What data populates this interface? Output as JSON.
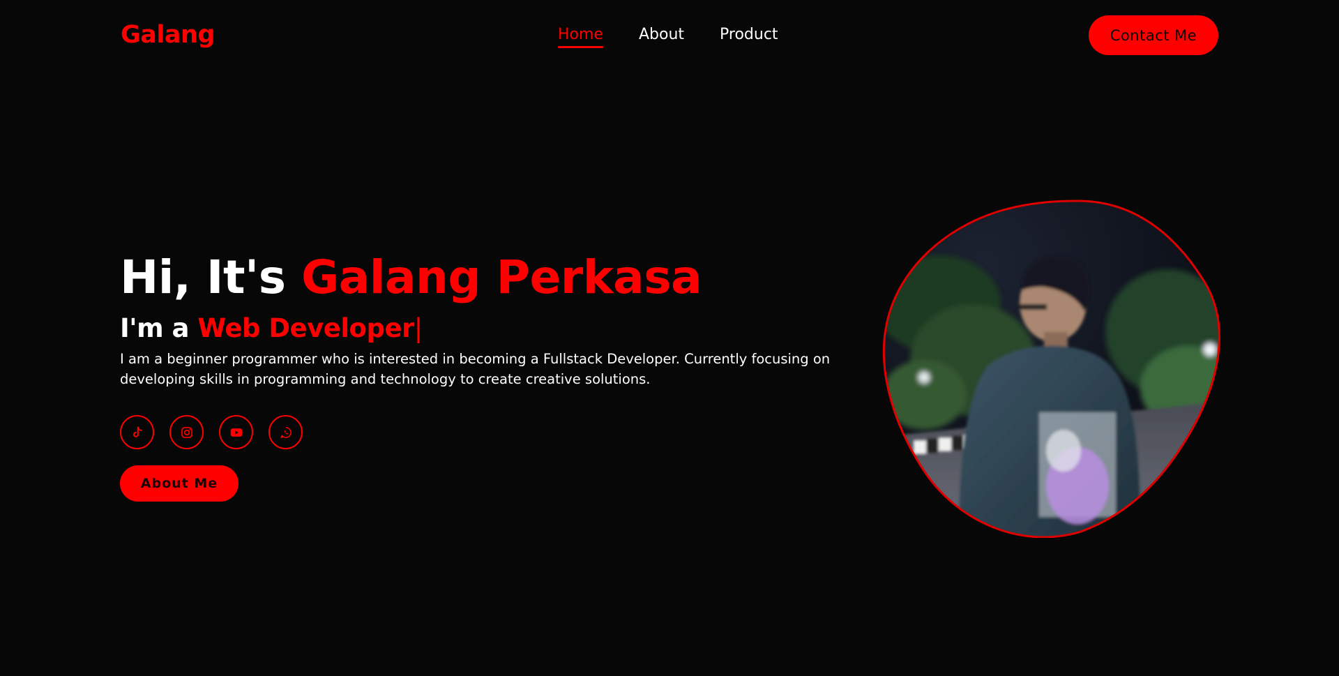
{
  "header": {
    "logo": "Galang",
    "nav": [
      {
        "label": "Home",
        "active": true
      },
      {
        "label": "About",
        "active": false
      },
      {
        "label": "Product",
        "active": false
      }
    ],
    "contact_label": "Contact Me"
  },
  "hero": {
    "greeting": "Hi, It's",
    "name": "Galang Perkasa",
    "role_prefix": "I'm a",
    "role": "Web Developer",
    "cursor": "|",
    "description": "I am a beginner programmer who is interested in becoming a Fullstack Developer. Currently focusing on developing skills in programming and technology to create creative solutions.",
    "socials": [
      {
        "icon": "tiktok-icon"
      },
      {
        "icon": "instagram-icon"
      },
      {
        "icon": "youtube-icon"
      },
      {
        "icon": "whatsapp-icon"
      }
    ],
    "about_label": "About Me"
  },
  "colors": {
    "background": "#080708",
    "accent": "#ff0000",
    "text": "#ffffff"
  }
}
